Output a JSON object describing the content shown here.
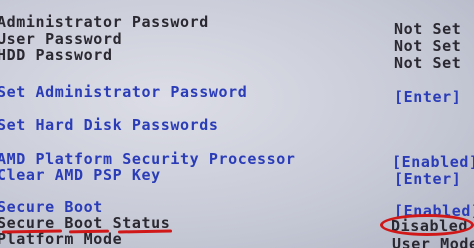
{
  "password_status": {
    "admin_label": "Administrator Password",
    "admin_value": "Not Set",
    "user_label": "User Password",
    "user_value": "Not Set",
    "hdd_label": "HDD Password",
    "hdd_value": "Not Set"
  },
  "actions": {
    "set_admin_label": "Set Administrator Password",
    "set_admin_value": "[Enter]",
    "set_hdd_label": "Set Hard Disk Passwords"
  },
  "amd_psp": {
    "processor_label": "AMD Platform Security Processor",
    "processor_value": "[Enabled]",
    "clear_label": "Clear AMD PSP Key",
    "clear_value": "[Enter]"
  },
  "secure_boot": {
    "label": "Secure Boot",
    "value": "[Enabled]",
    "status_label": "Secure Boot Status",
    "status_value": "Disabled",
    "platform_mode_label": "Platform Mode",
    "platform_mode_value": "User Mode"
  },
  "colors": {
    "text": "#2a2830",
    "selectable": "#2a3cb8",
    "annotation": "#d01818",
    "background": "#cfd1dc"
  }
}
